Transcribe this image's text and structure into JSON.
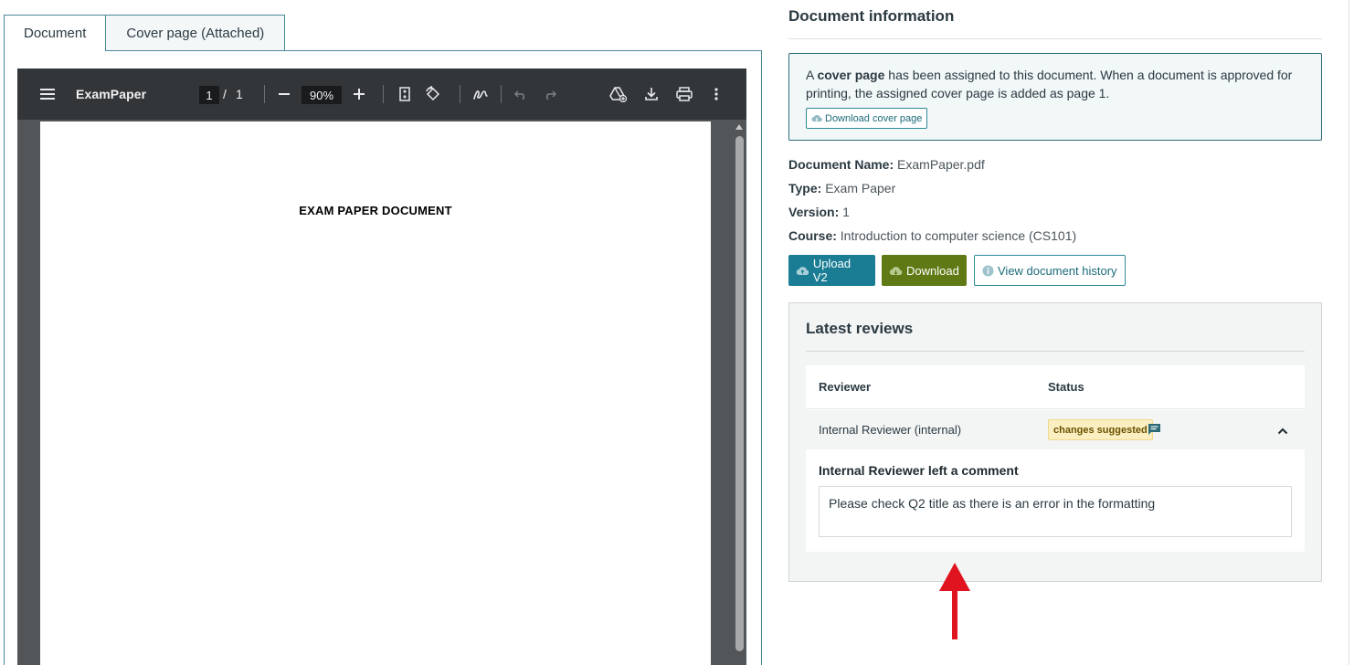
{
  "tabs": [
    {
      "label": "Document",
      "active": true
    },
    {
      "label": "Cover page (Attached)",
      "active": false
    }
  ],
  "viewer": {
    "title": "ExamPaper",
    "page_current": "1",
    "page_separator": "/",
    "page_total": "1",
    "zoom": "90%",
    "page_heading": "EXAM PAPER DOCUMENT",
    "icons": [
      "menu-icon",
      "zoom-out-icon",
      "zoom-in-icon",
      "fit-page-icon",
      "rotate-icon",
      "annotate-icon",
      "undo-icon",
      "redo-icon",
      "drive-add-icon",
      "download-icon",
      "print-icon",
      "more-icon"
    ]
  },
  "doc_info": {
    "title": "Document information",
    "notice": {
      "prefix": "A ",
      "bold": "cover page",
      "suffix": " has been assigned to this document. When a document is approved for printing, the assigned cover page is added as page 1.",
      "button": "Download cover page"
    },
    "fields": [
      {
        "key": "Document Name:",
        "value": "ExamPaper.pdf"
      },
      {
        "key": "Type:",
        "value": "Exam Paper"
      },
      {
        "key": "Version:",
        "value": "1"
      },
      {
        "key": "Course:",
        "value": "Introduction to computer science (CS101)"
      }
    ],
    "buttons": {
      "upload": "Upload V2",
      "download": "Download",
      "history": "View document history"
    }
  },
  "reviews": {
    "title": "Latest reviews",
    "columns": {
      "reviewer": "Reviewer",
      "status": "Status"
    },
    "rows": [
      {
        "reviewer": "Internal Reviewer (internal)",
        "status": "changes suggested",
        "comment_title": "Internal Reviewer left a comment",
        "comment": "Please check Q2 title as there is an error in the formatting"
      }
    ]
  },
  "colors": {
    "accent": "#1a7d94",
    "download": "#5f7a14",
    "badge_bg": "#fbeec0",
    "arrow": "#e0141e"
  }
}
